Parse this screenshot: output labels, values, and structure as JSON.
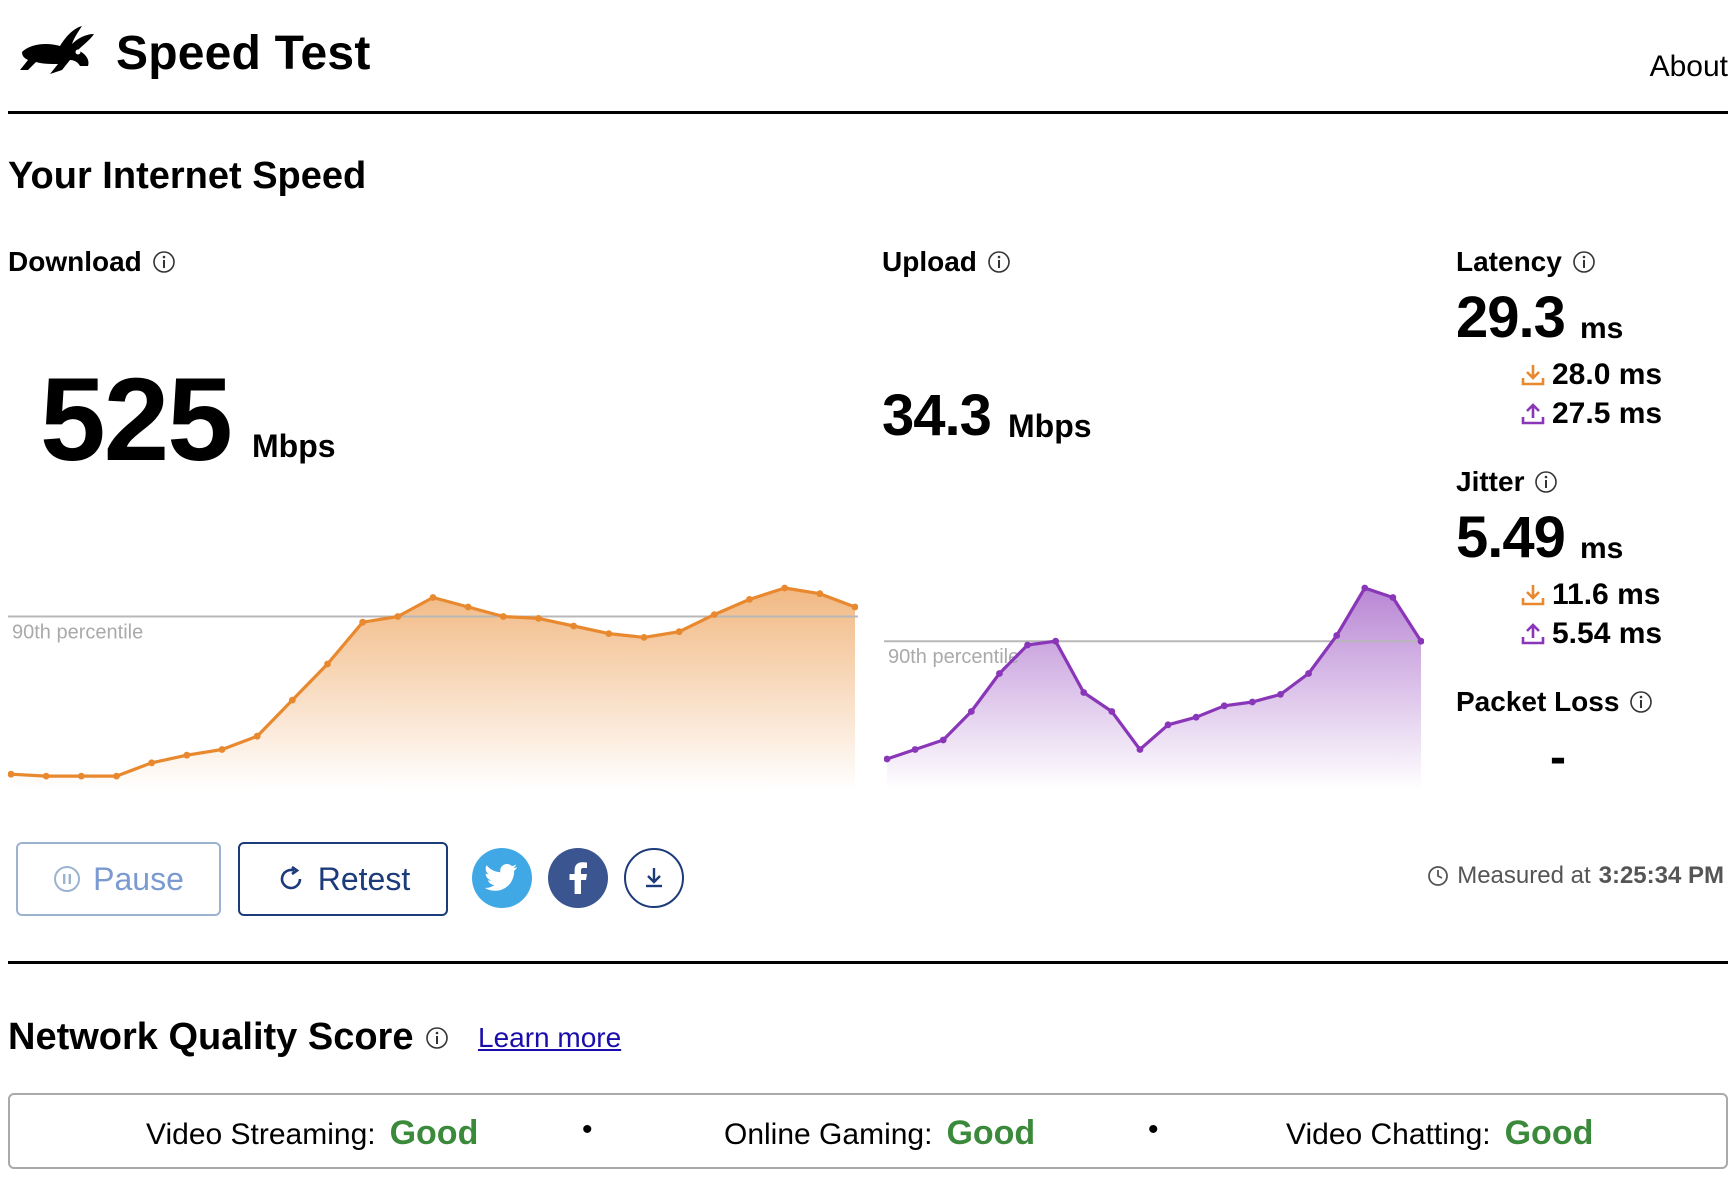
{
  "header": {
    "brand": "Speed Test",
    "about_label": "About",
    "logo_icon": "rabbit-icon"
  },
  "section_title": "Your Internet Speed",
  "download": {
    "label": "Download",
    "value": "525",
    "unit": "Mbps",
    "color": "#e8892f"
  },
  "upload": {
    "label": "Upload",
    "value": "34.3",
    "unit": "Mbps",
    "color": "#8a36b8"
  },
  "latency": {
    "label": "Latency",
    "value": "29.3",
    "unit": "ms",
    "download_value": "28.0 ms",
    "upload_value": "27.5 ms"
  },
  "jitter": {
    "label": "Jitter",
    "value": "5.49",
    "unit": "ms",
    "download_value": "11.6 ms",
    "upload_value": "5.54 ms"
  },
  "packet_loss": {
    "label": "Packet Loss",
    "value": "-"
  },
  "percentile_label": "90th percentile",
  "controls": {
    "pause_label": "Pause",
    "retest_label": "Retest",
    "share_twitter": "twitter-icon",
    "share_facebook": "facebook-icon",
    "download_results": "download-icon"
  },
  "measured": {
    "prefix": "Measured at",
    "time": "3:25:34 PM"
  },
  "network_quality": {
    "title": "Network Quality Score",
    "learn_more": "Learn more",
    "items": [
      {
        "label": "Video Streaming:",
        "value": "Good"
      },
      {
        "label": "Online Gaming:",
        "value": "Good"
      },
      {
        "label": "Video Chatting:",
        "value": "Good"
      }
    ],
    "separator": "•",
    "good_color": "#3b8a3b"
  },
  "chart_data": [
    {
      "type": "area",
      "series": [
        {
          "values": [
            0.02,
            0.01,
            0.01,
            0.01,
            0.08,
            0.12,
            0.15,
            0.22,
            0.41,
            0.6,
            0.82,
            0.85,
            0.95,
            0.9,
            0.85,
            0.84,
            0.8,
            0.76,
            0.74,
            0.77,
            0.86,
            0.94,
            1.0,
            0.97,
            0.9
          ]
        }
      ],
      "reference_line": {
        "label": "90th percentile",
        "value": 0.85
      },
      "ylim": [
        0,
        1
      ]
    },
    {
      "type": "area",
      "series": [
        {
          "values": [
            0.1,
            0.15,
            0.2,
            0.35,
            0.55,
            0.7,
            0.72,
            0.45,
            0.35,
            0.15,
            0.28,
            0.32,
            0.38,
            0.4,
            0.44,
            0.55,
            0.75,
            1.0,
            0.95,
            0.72
          ]
        }
      ],
      "reference_line": {
        "label": "90th percentile",
        "value": 0.72
      },
      "ylim": [
        0,
        1
      ]
    }
  ]
}
